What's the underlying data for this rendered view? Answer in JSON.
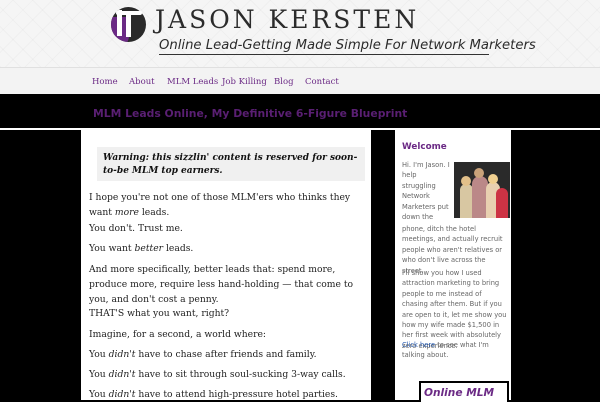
{
  "brand": {
    "logo_letter": "J",
    "name": "JASON KERSTEN",
    "tagline": "Online Lead-Getting Made Simple For Network Marketers"
  },
  "nav": {
    "items": [
      {
        "label": "Home"
      },
      {
        "label": "About"
      },
      {
        "label": "MLM Leads"
      },
      {
        "label": "Job Killing"
      },
      {
        "label": "Blog"
      },
      {
        "label": "Contact"
      }
    ]
  },
  "page": {
    "title": "MLM Leads Online, My Definitive 6-Figure Blueprint"
  },
  "content": {
    "warning": "Warning: this sizzlin' content is reserved for soon-to-be MLM top earners.",
    "paragraphs": [
      {
        "before": "I hope you're not one of those MLM'ers who thinks they want ",
        "em": "more",
        "after": " leads."
      },
      {
        "before": "You don't. Trust me.",
        "em": "",
        "after": ""
      },
      {
        "before": "You want ",
        "em": "better",
        "after": " leads."
      },
      {
        "before": "And more specifically, better leads that: spend more, produce more, require less hand-holding — that come to you, and don't cost a penny.",
        "em": "",
        "after": ""
      },
      {
        "before": "THAT'S what you want, right?",
        "em": "",
        "after": ""
      },
      {
        "before": "Imagine, for a second, a world where:",
        "em": "",
        "after": ""
      },
      {
        "before": "You ",
        "em": "didn't",
        "after": " have to chase after friends and family."
      },
      {
        "before": "You ",
        "em": "didn't",
        "after": " have to sit through soul-sucking 3-way calls."
      },
      {
        "before": "You ",
        "em": "didn't",
        "after": " have to attend high-pressure hotel parties."
      }
    ]
  },
  "sidebar": {
    "heading": "Welcome",
    "intro": "Hi. I'm Jason. I help struggling Network Marketers put down the phone, ditch the hotel meetings, and actually recruit people who aren't relatives or who don't live across the street.",
    "para2": "I'll show you how I used attraction marketing to bring people to me instead of chasing after them. But if you are open to it, let me show you how my wife made $1,500 in her first week with absolutely zero experience.",
    "link_text": "Click here",
    "para3_after": " to see what I'm talking about.",
    "banner_text": "Online MLM"
  },
  "colors": {
    "accent": "#6b2a85",
    "title": "#5a1f73",
    "link": "#2a5db0",
    "background": "#000000"
  }
}
